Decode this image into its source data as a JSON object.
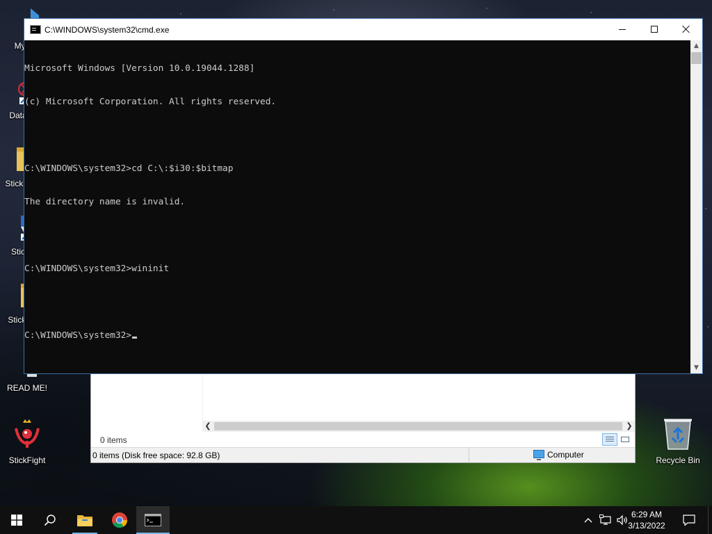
{
  "desktop": {
    "icons": [
      {
        "label": "My Co",
        "icon": "monitor-shortcut-icon"
      },
      {
        "label": "DataV",
        "icon": "app-shortcut-icon"
      },
      {
        "label": "Stick.",
        "icon": "folder-icon"
      },
      {
        "label": "Stic",
        "icon": "app-shortcut-icon"
      },
      {
        "label": "StickF",
        "icon": "folder-icon"
      },
      {
        "label": "READ ME!",
        "icon": "text-document-icon"
      },
      {
        "label": "StickFight",
        "icon": "stickfight-game-icon"
      },
      {
        "label": "Recycle Bin",
        "icon": "recycle-bin-icon"
      }
    ]
  },
  "cmd_window": {
    "title": "C:\\WINDOWS\\system32\\cmd.exe",
    "lines": [
      "Microsoft Windows [Version 10.0.19044.1288]",
      "(c) Microsoft Corporation. All rights reserved.",
      "",
      "C:\\WINDOWS\\system32>cd C:\\:$i30:$bitmap",
      "The directory name is invalid.",
      "",
      "C:\\WINDOWS\\system32>wininit",
      "",
      "C:\\WINDOWS\\system32>"
    ]
  },
  "explorer_window": {
    "items_count": "0 items",
    "status_text": "0 items (Disk free space: 92.8 GB)",
    "zone_label": "Computer"
  },
  "taskbar": {
    "buttons": [
      {
        "name": "start-button",
        "icon": "windows-logo-icon"
      },
      {
        "name": "search-button",
        "icon": "search-icon"
      },
      {
        "name": "file-explorer-button",
        "icon": "folder-icon"
      },
      {
        "name": "chrome-button",
        "icon": "chrome-icon"
      },
      {
        "name": "cmd-button",
        "icon": "command-prompt-icon"
      }
    ],
    "tray_icons": [
      "chevron-up-icon",
      "network-icon",
      "volume-icon"
    ],
    "clock": {
      "time": "6:29 AM",
      "date": "3/13/2022"
    },
    "action_center_icon": "notification-icon"
  }
}
